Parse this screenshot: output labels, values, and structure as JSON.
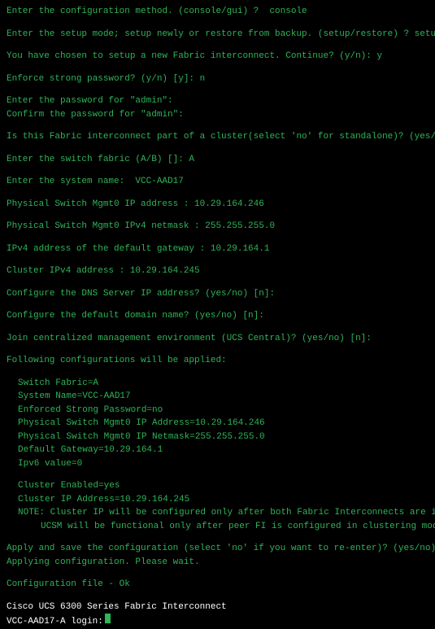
{
  "lines": {
    "l1": "Enter the configuration method. (console/gui) ?  console",
    "l2": "Enter the setup mode; setup newly or restore from backup. (setup/restore) ? setup",
    "l3": "You have chosen to setup a new Fabric interconnect. Continue? (y/n): y",
    "l4": "Enforce strong password? (y/n) [y]: n",
    "l5": "Enter the password for \"admin\":",
    "l6": "Confirm the password for \"admin\":",
    "l7": "Is this Fabric interconnect part of a cluster(select 'no' for standalone)? (yes/no) [n]: yes",
    "l8": "Enter the switch fabric (A/B) []: A",
    "l9": "Enter the system name:  VCC-AAD17",
    "l10": "Physical Switch Mgmt0 IP address : 10.29.164.246",
    "l11": "Physical Switch Mgmt0 IPv4 netmask : 255.255.255.0",
    "l12": "IPv4 address of the default gateway : 10.29.164.1",
    "l13": "Cluster IPv4 address : 10.29.164.245",
    "l14": "Configure the DNS Server IP address? (yes/no) [n]:",
    "l15": "Configure the default domain name? (yes/no) [n]:",
    "l16": "Join centralized management environment (UCS Central)? (yes/no) [n]:",
    "l17": "Following configurations will be applied:",
    "c1": "Switch Fabric=A",
    "c2": "System Name=VCC-AAD17",
    "c3": "Enforced Strong Password=no",
    "c4": "Physical Switch Mgmt0 IP Address=10.29.164.246",
    "c5": "Physical Switch Mgmt0 IP Netmask=255.255.255.0",
    "c6": "Default Gateway=10.29.164.1",
    "c7": "Ipv6 value=0",
    "c8": "Cluster Enabled=yes",
    "c9": "Cluster IP Address=10.29.164.245",
    "note1": "NOTE: Cluster IP will be configured only after both Fabric Interconnects are initialized.",
    "note2": "UCSM will be functional only after peer FI is configured in clustering mode.",
    "l18": "Apply and save the configuration (select 'no' if you want to re-enter)? (yes/no): yes",
    "l19": "Applying configuration. Please wait.",
    "l20": "Configuration file - Ok",
    "banner": "Cisco UCS 6300 Series Fabric Interconnect",
    "prompt": "VCC-AAD17-A login:"
  }
}
